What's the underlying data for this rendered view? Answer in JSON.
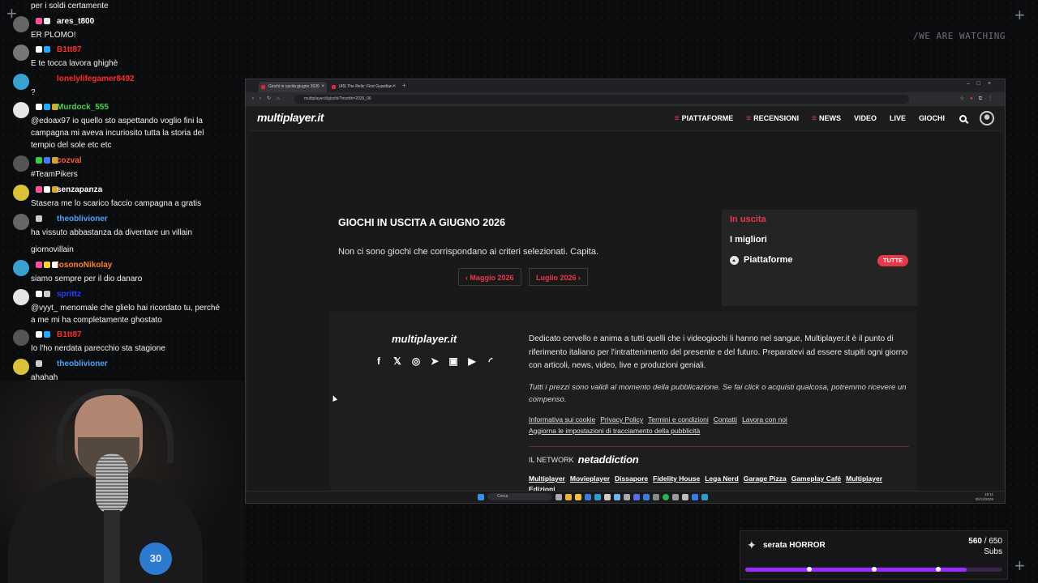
{
  "overlay": {
    "watermark": "/WE ARE WATCHING",
    "goal": {
      "title": "serata HORROR",
      "current": "560",
      "separator": " / ",
      "target": "650",
      "unit": "Subs",
      "progress": 0.8615,
      "milestones": [
        0.25,
        0.5,
        0.75
      ]
    }
  },
  "chat": [
    {
      "user": "",
      "color": "#ffffff",
      "text": "per i soldi certamente",
      "badges": []
    },
    {
      "user": "ares_t800",
      "color": "#ffffff",
      "text": "ER PLOMO!",
      "badges": [
        "#ff4f9a",
        "#e8e8e8"
      ]
    },
    {
      "user": "B1tt87",
      "color": "#ff2a2a",
      "text": "E te tocca lavora ghighè",
      "badges": [
        "#ffffff",
        "#22a8ff"
      ]
    },
    {
      "user": "lonelylifegamer8492",
      "color": "#ff2a2a",
      "text": "?",
      "badges": []
    },
    {
      "user": "Murdock_555",
      "color": "#45d14b",
      "text": "@edoax97 io quello sto aspettando voglio fini la campagna mi aveva incuriosito tutta la storia del tempio del sole etc etc",
      "badges": [
        "#ffffff",
        "#22a8ff",
        "#d4a634"
      ]
    },
    {
      "user": "cozval",
      "color": "#ff5a3a",
      "text": "#TeamPikers",
      "badges": [
        "#3ec94c",
        "#3f7bff",
        "#d4a634"
      ]
    },
    {
      "user": "senzapanza",
      "color": "#ffffff",
      "text": "Stasera me lo scarico faccio campagna a gratis",
      "badges": [
        "#ff4f9a",
        "#ffffff",
        "#d4a634"
      ]
    },
    {
      "user": "theoblivioner",
      "color": "#4aa3ff",
      "text": "ha vissuto abbastanza da diventare un villain",
      "badges": [
        "#cccccc"
      ]
    },
    {
      "user": "",
      "color": "#ffffff",
      "text": "giornovillain",
      "badges": []
    },
    {
      "user": "iosonoNikolay",
      "color": "#ff7f2a",
      "text": "siamo sempre per il dio danaro",
      "badges": [
        "#ff4f9a",
        "#ffd23c",
        "#ffffff"
      ]
    },
    {
      "user": "sprittz",
      "color": "#2a3dff",
      "text": "@vyyt_ menomale che glielo hai ricordato tu, perché a me mi ha completamente ghostato",
      "badges": [
        "#ffffff",
        "#cccccc"
      ]
    },
    {
      "user": "B1tt87",
      "color": "#ff2a2a",
      "text": "Io l'ho nerdata parecchio sta stagione",
      "badges": [
        "#ffffff",
        "#22a8ff"
      ]
    },
    {
      "user": "theoblivioner",
      "color": "#4aa3ff",
      "text": "ahahah",
      "badges": [
        "#cccccc"
      ]
    }
  ],
  "webcam": {
    "cap_text": "30"
  },
  "browser": {
    "tabs": [
      {
        "label": "Giochi in uscita giugno 2026",
        "active": true
      },
      {
        "label": "(45) The Relic: First Guardian",
        "active": false
      }
    ],
    "url": "multiplayer.it/giochi/?month=2026_06",
    "nav_icons": [
      "back-icon",
      "forward-icon",
      "reload-icon",
      "home-icon"
    ],
    "page": {
      "brand": "multiplayer.it",
      "menu": [
        {
          "label": "PIATTAFORME",
          "burger": true
        },
        {
          "label": "RECENSIONI",
          "burger": true
        },
        {
          "label": "NEWS",
          "burger": true
        },
        {
          "label": "VIDEO",
          "burger": false
        },
        {
          "label": "LIVE",
          "burger": false
        },
        {
          "label": "GIOCHI",
          "burger": false
        }
      ],
      "title": "GIOCHI IN USCITA A GIUGNO 2026",
      "empty_message": "Non ci sono giochi che corrispondano ai criteri selezionati. Capita.",
      "prev_month": "Maggio 2026",
      "next_month": "Luglio 2026",
      "sidebar": {
        "in_uscita": "In uscita",
        "migliori": "I migliori",
        "piattaforme": "Piattaforme",
        "tutte": "TUTTE"
      },
      "footer": {
        "brand": "multiplayer.it",
        "socials": [
          "facebook-icon",
          "x-icon",
          "instagram-icon",
          "telegram-icon",
          "twitch-icon",
          "youtube-icon",
          "rss-icon"
        ],
        "description": "Dedicato cervello e anima a tutti quelli che i videogiochi li hanno nel sangue, Multiplayer.it è il punto di riferimento italiano per l'intrattenimento del presente e del futuro. Preparatevi ad essere stupiti ogni giorno con articoli, news, video, live e produzioni geniali.",
        "disclaimer": "Tutti i prezzi sono validi al momento della pubblicazione. Se fai click o acquisti qualcosa, potremmo ricevere un compenso.",
        "links": [
          "Informativa sui cookie",
          "Privacy Policy",
          "Termini e condizioni",
          "Contatti",
          "Lavora con noi",
          "Aggiorna le impostazioni di tracciamento della pubblicità"
        ],
        "network_label": "IL NETWORK",
        "network_name": "netaddiction",
        "sites": [
          "Multiplayer",
          "Movieplayer",
          "Dissapore",
          "Fidelity House",
          "Lega Nerd",
          "Garage Pizza",
          "Gameplay Café",
          "Multiplayer Edizioni"
        ]
      }
    },
    "taskbar": {
      "search": "Cerca",
      "time": "18:11",
      "date": "30/12/2025"
    }
  },
  "colors": {
    "accent": "#e8394b",
    "goal": "#9b2cff"
  }
}
